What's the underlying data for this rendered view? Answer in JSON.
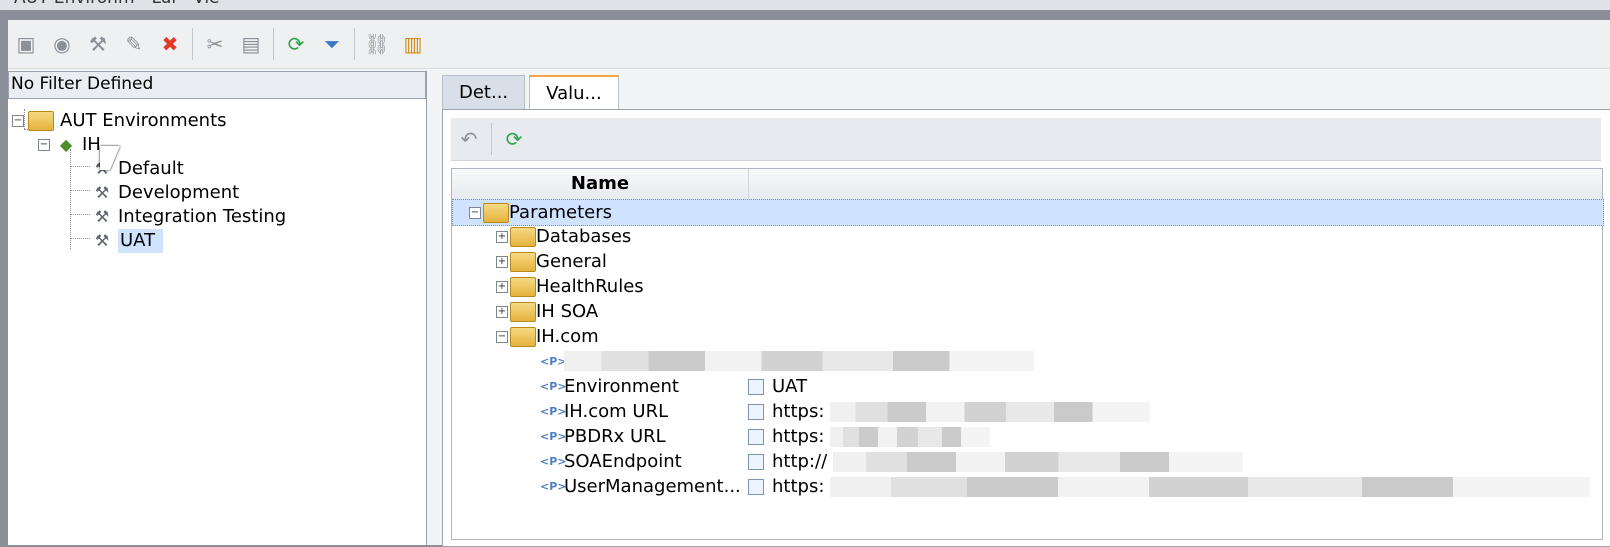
{
  "window": {
    "title": "AUT Environm - Lui - Vie"
  },
  "toolbar": {
    "icons": [
      "folder-add",
      "users",
      "settings",
      "edit",
      "delete",
      "cut",
      "paste",
      "refresh",
      "filter",
      "link",
      "document"
    ]
  },
  "left_panel": {
    "filter_text": "No Filter Defined",
    "tree": {
      "root": "AUT Environments",
      "app": "IH",
      "children": [
        "Default",
        "Development",
        "Integration Testing",
        "UAT"
      ]
    }
  },
  "right_panel": {
    "tabs": [
      "Det...",
      "Valu..."
    ],
    "grid": {
      "header": "Name",
      "rows": [
        {
          "label": "Parameters"
        },
        {
          "label": "Databases"
        },
        {
          "label": "General"
        },
        {
          "label": "HealthRules"
        },
        {
          "label": "IH SOA"
        },
        {
          "label": "IH.com"
        },
        {
          "label": "Environment",
          "value": "UAT"
        },
        {
          "label": "IH.com URL",
          "value": "https:"
        },
        {
          "label": "PBDRx URL",
          "value": "https:"
        },
        {
          "label": "SOAEndpoint",
          "value": "http://"
        },
        {
          "label": "UserManagement...",
          "value": "https:"
        }
      ]
    }
  }
}
